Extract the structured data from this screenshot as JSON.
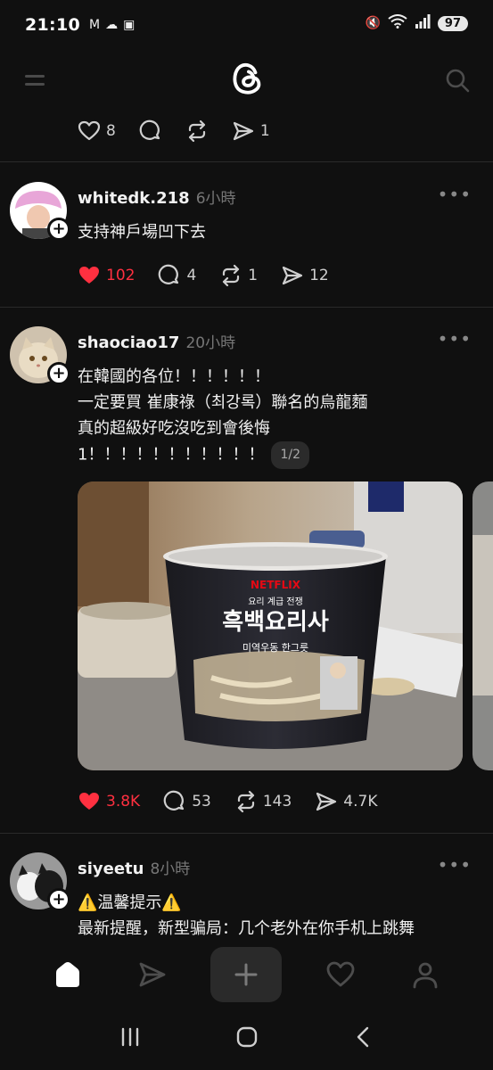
{
  "status_bar": {
    "time": "21:10",
    "left_icons": [
      "gmail-icon",
      "cloud-icon",
      "sim-icon"
    ],
    "right_icons": [
      "mute-icon",
      "wifi-icon",
      "signal-icon"
    ],
    "battery": "97"
  },
  "header": {
    "logo": "threads-logo",
    "menu_icon": "menu-icon",
    "search_icon": "search-icon"
  },
  "top_post_actions": {
    "likes": "8",
    "replies": "",
    "reposts": "",
    "shares": "1"
  },
  "posts": [
    {
      "username": "whitedk.218",
      "time": "6小時",
      "lines": [
        "支持神戶場凹下去"
      ],
      "likes": "102",
      "liked": true,
      "replies": "4",
      "reposts": "1",
      "shares": "12"
    },
    {
      "username": "shaociao17",
      "time": "20小時",
      "lines": [
        "在韓國的各位！！！！！！",
        "一定要買 崔康祿（최강록）聯名的烏龍麵",
        "真的超級好吃沒吃到會後悔",
        "1！！！！！！！！！！！"
      ],
      "pager": "1/2",
      "image_text": {
        "brand": "NETFLIX",
        "sub": "요리 계급 전쟁",
        "title": "흑백요리사",
        "product": "미역우동 한그릇"
      },
      "likes": "3.8K",
      "liked": true,
      "replies": "53",
      "reposts": "143",
      "shares": "4.7K"
    },
    {
      "username": "siyeetu",
      "time": "8小時",
      "lines": [
        "⚠️温馨提示⚠️",
        "最新提醒，新型骗局：几个老外在你手机上跳舞"
      ]
    }
  ],
  "colors": {
    "background": "#101010",
    "like_red": "#ff3040",
    "muted": "#777777"
  }
}
